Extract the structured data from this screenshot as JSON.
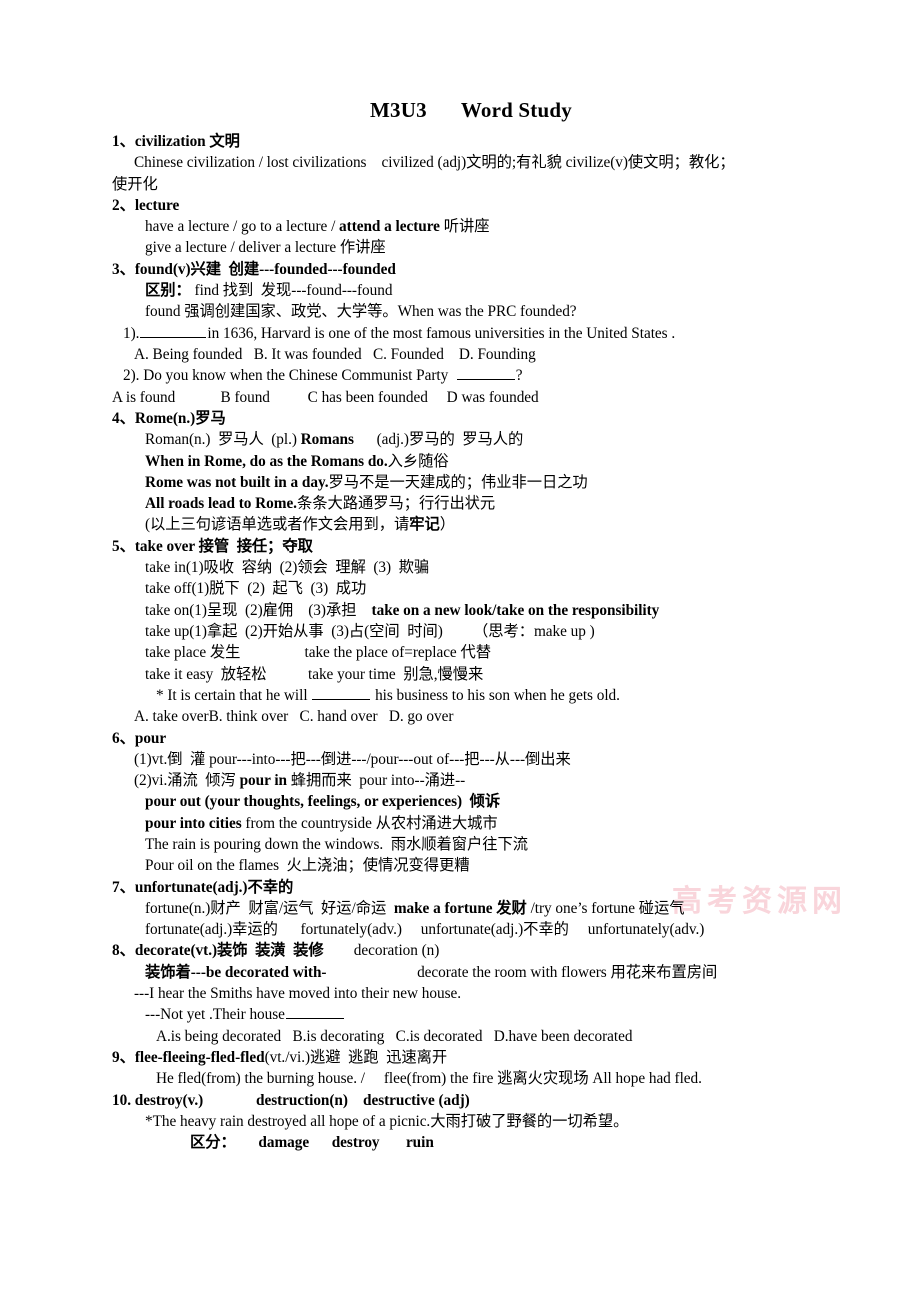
{
  "document": {
    "title_part1": "M3U3",
    "title_part2": "Word Study",
    "watermark": "高考资源网"
  },
  "entries": [
    {
      "number": "1、",
      "headword": "civilization 文明",
      "lines": [
        {
          "indent": "i2",
          "text": "Chinese civilization / lost civilizations    civilized (adj)文明的;有礼貌 civilize(v)使文明；教化；"
        },
        {
          "indent": "i0",
          "text": "使开化"
        }
      ]
    },
    {
      "number": "2、",
      "headword": "lecture",
      "lines": [
        {
          "indent": "i3",
          "text_pre": "have a lecture / go to a lecture / ",
          "text_bold": "attend a lecture",
          "text_post": " 听讲座"
        },
        {
          "indent": "i3",
          "text": "give a lecture / deliver a lecture 作讲座"
        }
      ]
    },
    {
      "number": "3、",
      "headword": "found(v)兴建  创建---founded---founded",
      "lines": [
        {
          "indent": "i3",
          "text_bold": "区别：",
          "text_post": " find 找到  发现---found---found"
        },
        {
          "indent": "i3",
          "text": "found 强调创建国家、政党、大学等。When was the PRC founded?"
        },
        {
          "indent": "i1",
          "text_pre": "1).",
          "blank": "blank-l",
          "text_post": "in 1636, Harvard is one of the most famous universities in the United States ."
        },
        {
          "indent": "i2",
          "text": "A. Being founded   B. It was founded   C. Founded    D. Founding"
        },
        {
          "indent": "i1",
          "text_pre": "2). Do you know when the Chinese Communist Party  ",
          "blank": "blank-m",
          "text_post": "?"
        },
        {
          "indent": "i0",
          "text": "A is found            B found          C has been founded     D was founded"
        }
      ]
    },
    {
      "number": "4、",
      "headword": "Rome(n.)罗马",
      "lines": [
        {
          "indent": "i3",
          "text_pre": "Roman(n.)  罗马人  (pl.) ",
          "text_bold": "Romans",
          "text_post": "      (adj.)罗马的  罗马人的"
        },
        {
          "indent": "i3",
          "text_bold": "When in Rome, do as the Romans do.",
          "text_post": "入乡随俗"
        },
        {
          "indent": "i3",
          "text_bold": "Rome was not built in a day.",
          "text_post": "罗马不是一天建成的；伟业非一日之功"
        },
        {
          "indent": "i3",
          "text_bold": "All roads lead to Rome.",
          "text_post": "条条大路通罗马；行行出状元"
        },
        {
          "indent": "i3",
          "text_pre": "(以上三句谚语单选或者作文会用到，请",
          "text_bold": "牢记",
          "text_post": "）"
        }
      ]
    },
    {
      "number": "5、",
      "headword": "take over 接管  接任；夺取",
      "lines": [
        {
          "indent": "i3",
          "text": "take in(1)吸收  容纳  (2)领会  理解  (3)  欺骗"
        },
        {
          "indent": "i3",
          "text": "take off(1)脱下  (2)  起飞  (3)  成功"
        },
        {
          "indent": "i3",
          "text_pre": "take on(1)呈现  (2)雇佣    (3)承担    ",
          "text_bold": "take on a new look/take on the responsibility"
        },
        {
          "indent": "i3",
          "text": "take up(1)拿起  (2)开始从事  (3)占(空间  时间)        （思考：make up )"
        },
        {
          "indent": "i3",
          "text": "take place 发生                 take the place of=replace 代替"
        },
        {
          "indent": "i3",
          "text": "take it easy  放轻松           take your time  别急,慢慢来"
        },
        {
          "indent": "i4",
          "text_pre": "* It is certain that he will ",
          "blank": "blank-m",
          "text_post": " his business to his son when he gets old."
        },
        {
          "indent": "i2",
          "text": "A. take overB. think over   C. hand over   D. go over"
        }
      ]
    },
    {
      "number": "6、",
      "headword": "pour",
      "lines": [
        {
          "indent": "i2",
          "text": "(1)vt.倒  灌 pour---into---把---倒进---/pour---out of---把---从---倒出来"
        },
        {
          "indent": "i2",
          "text_pre": "(2)vi.涌流  倾泻 ",
          "text_bold": "pour in",
          "text_post": " 蜂拥而来  pour into--涌进--"
        },
        {
          "indent": "i3",
          "text_bold": "pour out (your thoughts, feelings, or experiences)  倾诉"
        },
        {
          "indent": "i3",
          "text_bold": "pour into cities",
          "text_post": " from the countryside 从农村涌进大城市"
        },
        {
          "indent": "i3",
          "text": "The rain is pouring down the windows.  雨水顺着窗户往下流"
        },
        {
          "indent": "i3",
          "text": "Pour oil on the flames  火上浇油；使情况变得更糟"
        }
      ]
    },
    {
      "number": "7、",
      "headword": "unfortunate(adj.)不幸的",
      "lines": [
        {
          "indent": "i3",
          "text_pre": "fortune(n.)财产  财富/运气  好运/命运  ",
          "text_bold": "make a fortune 发财",
          "text_post": " /try one’s fortune 碰运气"
        },
        {
          "indent": "i3",
          "text": "fortunate(adj.)幸运的      fortunately(adv.)     unfortunate(adj.)不幸的     unfortunately(adv.)"
        }
      ]
    },
    {
      "number": "8、",
      "headword": "decorate(vt.)装饰  装潢  装修",
      "headword_extra": "        decoration (n)",
      "lines": [
        {
          "indent": "i3",
          "text_bold": "装饰着---be decorated with-",
          "text_post": "                        decorate the room with flowers 用花来布置房间"
        },
        {
          "indent": "i2",
          "text": "---I hear the Smiths have moved into their new house."
        },
        {
          "indent": "i3",
          "text_pre": "---Not yet .Their house",
          "blank": "blank-m"
        },
        {
          "indent": "i4",
          "text": "A.is being decorated   B.is decorating   C.is decorated   D.have been decorated"
        }
      ]
    },
    {
      "number": "9、",
      "headword": "flee-fleeing-fled-fled",
      "headword_plain": "(vt./vi.)逃避  逃跑  迅速离开",
      "lines": [
        {
          "indent": "i4",
          "text": "He fled(from) the burning house. /     flee(from) the fire 逃离火灾现场 All hope had fled."
        }
      ]
    },
    {
      "number": "10. ",
      "headword": "destroy(v.)              destruction(n)    destructive (adj)",
      "lines": [
        {
          "indent": "i3",
          "text": "*The heavy rain destroyed all hope of a picnic.大雨打破了野餐的一切希望。"
        },
        {
          "indent": "i6",
          "text_bold": "区分：      damage      destroy       ruin"
        }
      ]
    }
  ]
}
